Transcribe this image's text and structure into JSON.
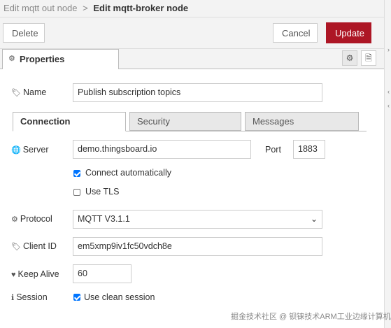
{
  "breadcrumb": {
    "previous": "Edit mqtt out node",
    "separator": ">",
    "current": "Edit mqtt-broker node"
  },
  "buttons": {
    "delete": "Delete",
    "cancel": "Cancel",
    "update": "Update"
  },
  "tabs": {
    "properties": "Properties"
  },
  "fields": {
    "name": {
      "label": "Name",
      "value": "Publish subscription topics"
    }
  },
  "connection_tabs": [
    "Connection",
    "Security",
    "Messages"
  ],
  "connection": {
    "server": {
      "label": "Server",
      "value": "demo.thingsboard.io"
    },
    "port": {
      "label": "Port",
      "value": "1883"
    },
    "connect_automatically": {
      "label": "Connect automatically",
      "checked": true
    },
    "use_tls": {
      "label": "Use TLS",
      "checked": false
    },
    "protocol": {
      "label": "Protocol",
      "value": "MQTT V3.1.1"
    },
    "client_id": {
      "label": "Client ID",
      "value": "em5xmp9iv1fc50vdch8e"
    },
    "keep_alive": {
      "label": "Keep Alive",
      "value": "60"
    },
    "session": {
      "label": "Session",
      "option_label": "Use clean session",
      "checked": true
    }
  },
  "watermark": "掘金技术社区 @ 钡铼技术ARM工业边缘计算机",
  "colors": {
    "update_button": "#ad1625",
    "checkbox": "#0075ff"
  }
}
